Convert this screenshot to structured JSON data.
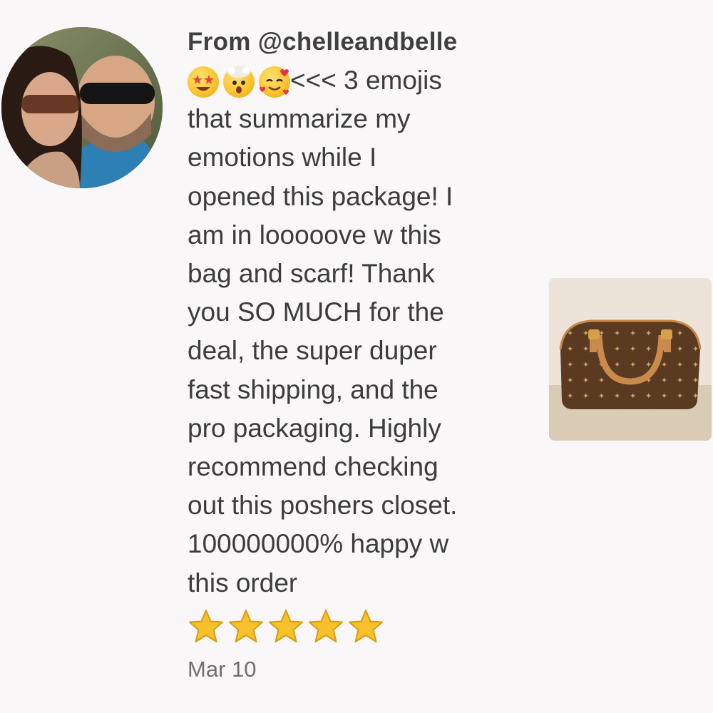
{
  "review": {
    "from_label": "From @chelleandbelle",
    "emojis": [
      "star-struck-emoji",
      "exploding-head-emoji",
      "smiling-face-with-hearts-emoji"
    ],
    "message_lines": [
      "<<< 3 emojis",
      "that summarize my",
      "emotions while I",
      "opened this package! I",
      "am in looooove w this",
      "bag and scarf! Thank",
      "you SO MUCH for the",
      "deal, the super duper",
      "fast shipping, and the",
      "pro packaging. Highly",
      "recommend checking",
      "out this poshers closet.",
      "100000000% happy w",
      "this order"
    ],
    "rating": 5,
    "date": "Mar 10"
  },
  "colors": {
    "background": "#f9f7f8",
    "text": "#3c3c3c",
    "date": "#6f6f6f",
    "star": "#f6c12a"
  }
}
